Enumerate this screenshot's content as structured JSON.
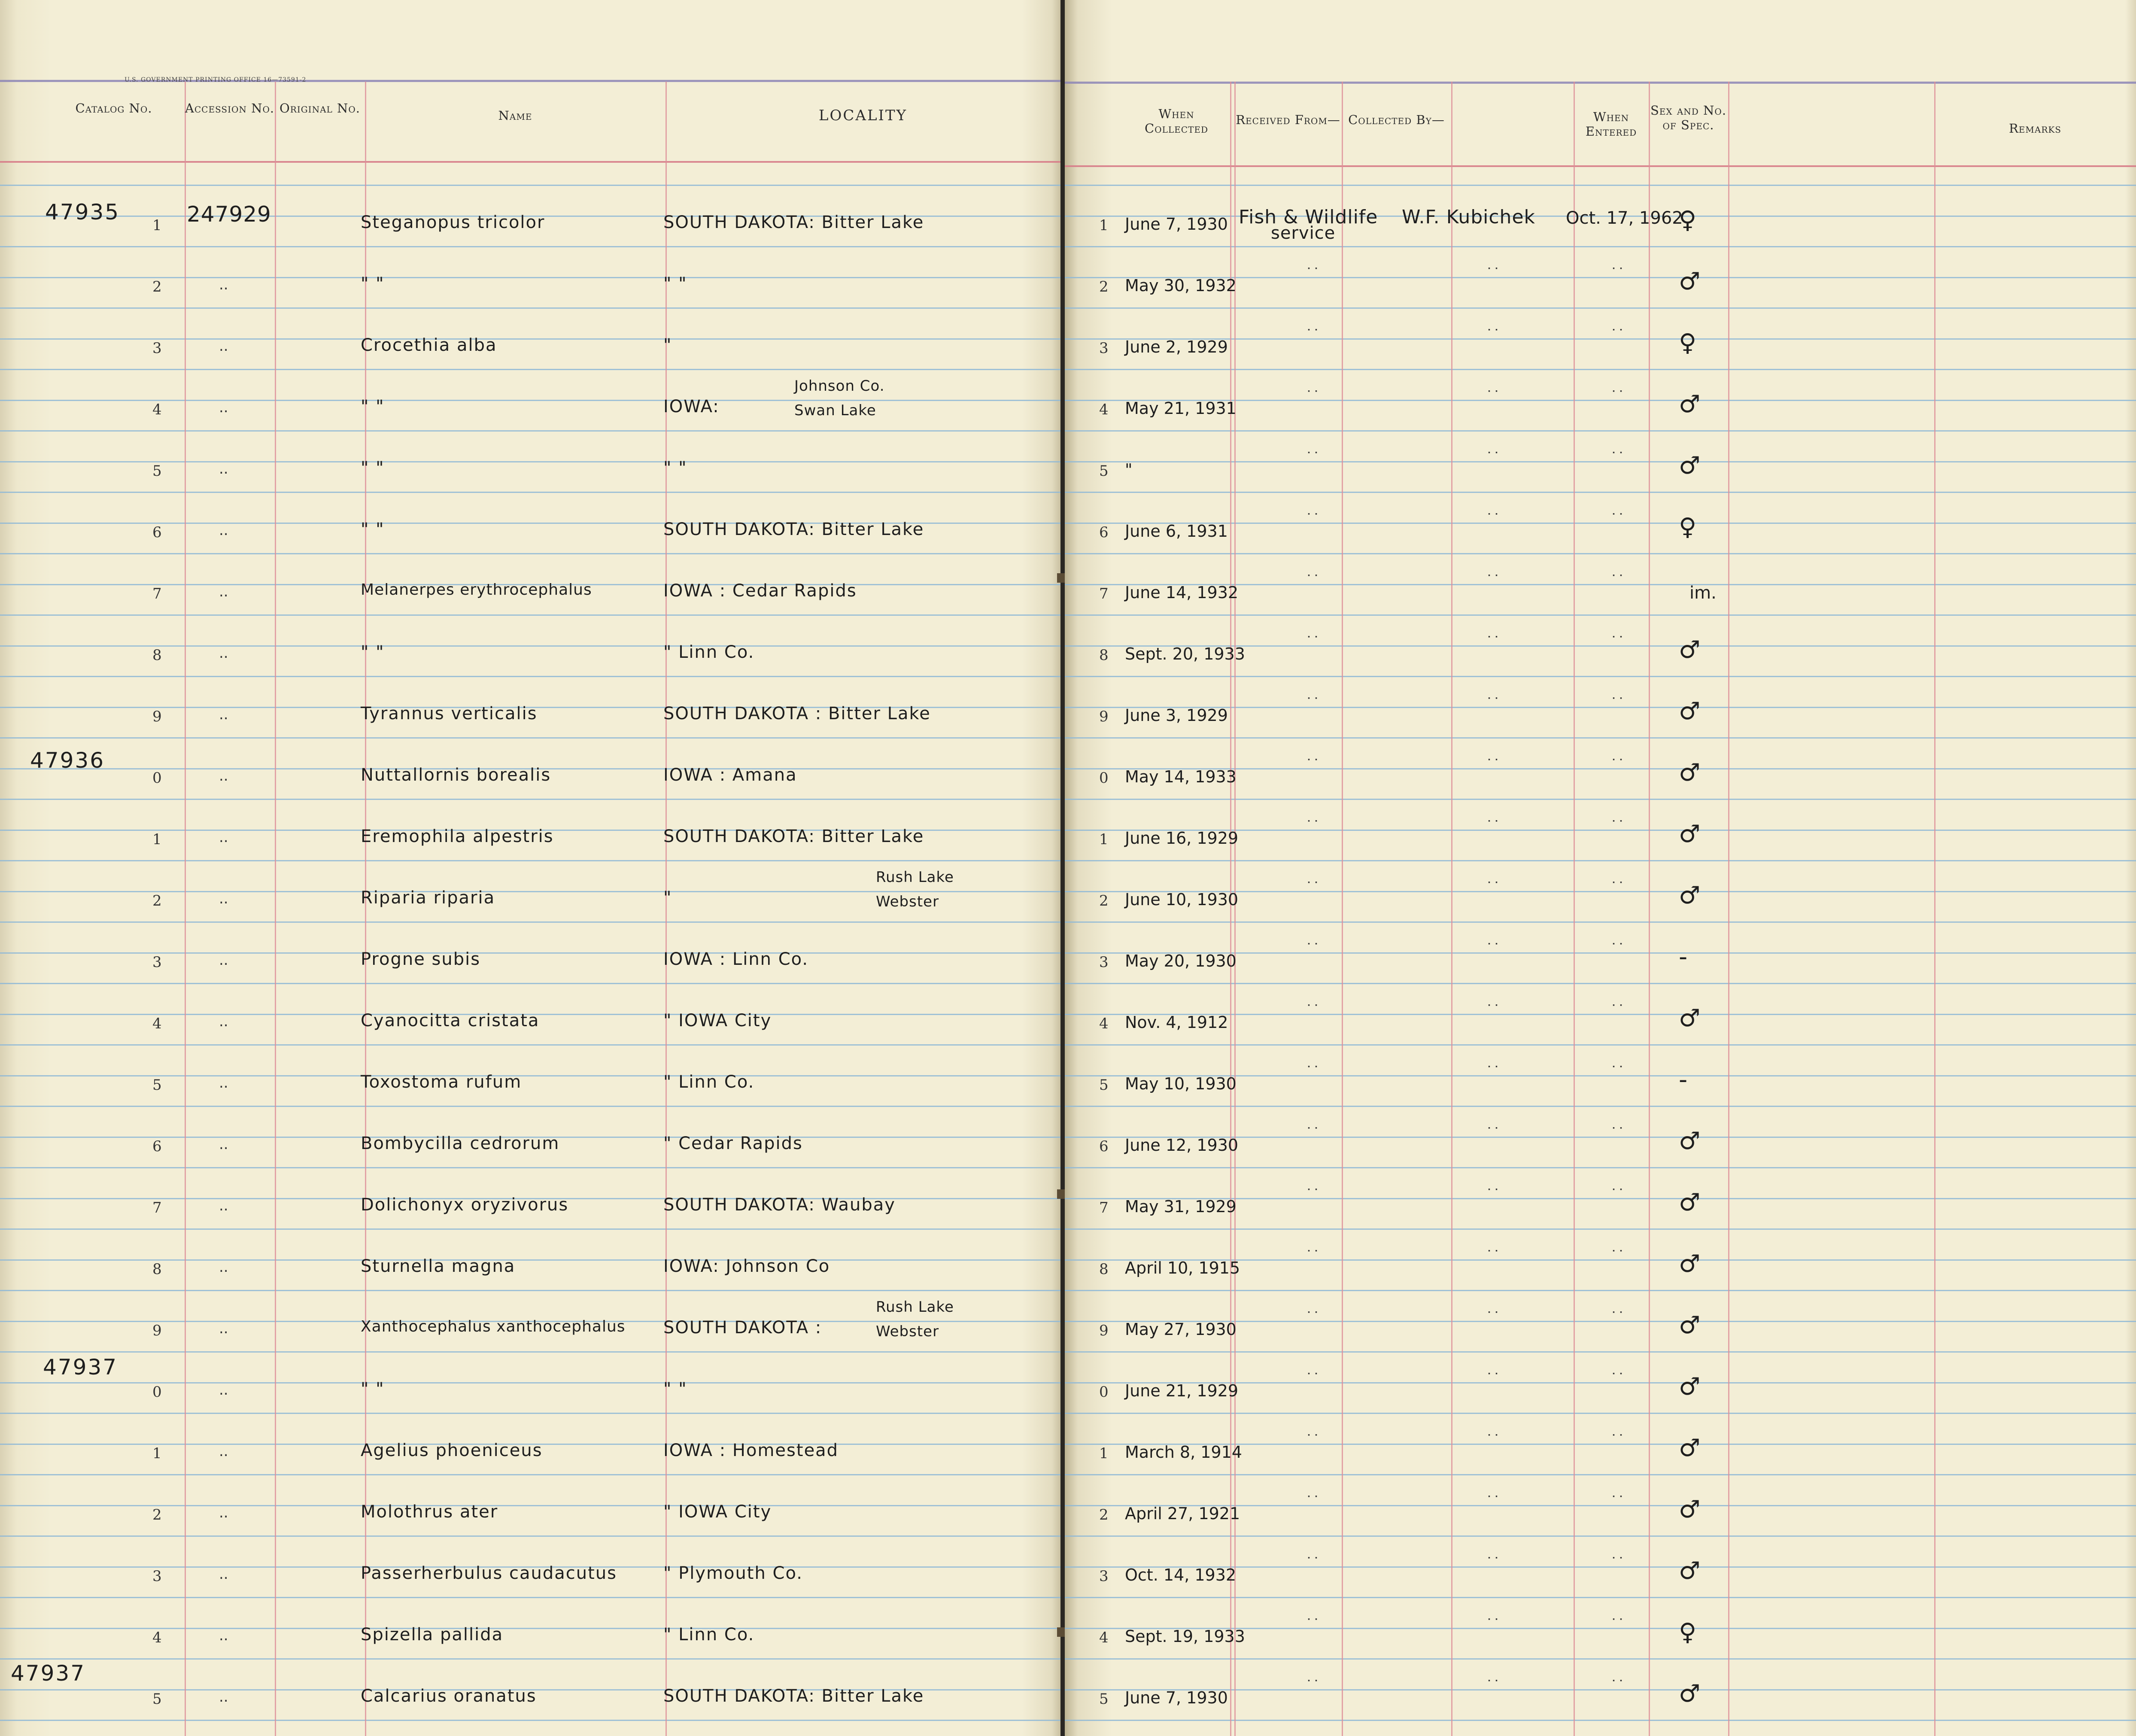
{
  "header": {
    "printer_line": "U.S. GOVERNMENT PRINTING OFFICE 16—73591-2",
    "left_columns": {
      "catalog": "Catalog No.",
      "accession": "Accession No.",
      "original": "Original No.",
      "name": "Name",
      "locality": "LOCALITY"
    },
    "right_columns": {
      "when_collected": "When Collected",
      "received_from": "Received From—",
      "collected_by": "Collected By—",
      "when_entered": "When Entered",
      "sex": "Sex and No. of Spec.",
      "remarks": "Remarks"
    }
  },
  "first_entry": {
    "catalog": "47935",
    "accession": "247929",
    "received_from_1": "Fish & Wildlife",
    "received_from_2": "service",
    "collected_by": "W.F. Kubichek",
    "entered": "Oct. 17, 1962"
  },
  "catalog_prefixes": {
    "r10": "47936",
    "r20": "47937",
    "r25": "47937"
  },
  "rows": [
    {
      "n": "1",
      "name": "Steganopus   tricolor",
      "loc": "SOUTH  DAKOTA:  Bitter  Lake",
      "date": "June 7, 1930",
      "sex": "♀"
    },
    {
      "n": "2",
      "name": "\"          \"",
      "loc": "\"                \"",
      "date": "May 30, 1932",
      "sex": "♂"
    },
    {
      "n": "3",
      "name": "Crocethia   alba",
      "loc": "\"",
      "date": "June 2, 1929",
      "sex": "♀"
    },
    {
      "n": "4",
      "name": "\"          \"",
      "loc": "IOWA:",
      "loc2a": "Johnson Co.",
      "loc2b": "Swan Lake",
      "date": "May 21, 1931",
      "sex": "♂"
    },
    {
      "n": "5",
      "name": "\"          \"",
      "loc": "\"        \"",
      "date": "\"",
      "sex": "♂"
    },
    {
      "n": "6",
      "name": "\"          \"",
      "loc": "SOUTH  DAKOTA:  Bitter  Lake",
      "date": "June 6, 1931",
      "sex": "♀"
    },
    {
      "n": "7",
      "name": "Melanerpes  erythrocephalus",
      "loc": "IOWA :  Cedar  Rapids",
      "date": "June 14, 1932",
      "sex": "im."
    },
    {
      "n": "8",
      "name": "\"          \"",
      "loc": "\"           Linn  Co.",
      "date": "Sept. 20, 1933",
      "sex": "♂"
    },
    {
      "n": "9",
      "name": "Tyrannus   verticalis",
      "loc": "SOUTH  DAKOTA :  Bitter  Lake",
      "date": "June 3, 1929",
      "sex": "♂"
    },
    {
      "n": "0",
      "name": "Nuttallornis   borealis",
      "loc": "IOWA :  Amana",
      "date": "May 14, 1933",
      "sex": "♂"
    },
    {
      "n": "1",
      "name": "Eremophila   alpestris",
      "loc": "SOUTH  DAKOTA:  Bitter  Lake",
      "date": "June 16, 1929",
      "sex": "♂"
    },
    {
      "n": "2",
      "name": "Riparia   riparia",
      "loc": "\"",
      "loc2a": "Rush  Lake",
      "loc2b": "Webster",
      "date": "June 10, 1930",
      "sex": "♂"
    },
    {
      "n": "3",
      "name": "Progne   subis",
      "loc": "IOWA :      Linn  Co.",
      "date": "May 20, 1930",
      "sex": "-"
    },
    {
      "n": "4",
      "name": "Cyanocitta   cristata",
      "loc": "\"           IOWA  City",
      "date": "Nov. 4, 1912",
      "sex": "♂"
    },
    {
      "n": "5",
      "name": "Toxostoma   rufum",
      "loc": "\"           Linn  Co.",
      "date": "May 10, 1930",
      "sex": "-"
    },
    {
      "n": "6",
      "name": "Bombycilla   cedrorum",
      "loc": "\"         Cedar  Rapids",
      "date": "June 12, 1930",
      "sex": "♂"
    },
    {
      "n": "7",
      "name": "Dolichonyx   oryzivorus",
      "loc": "SOUTH  DAKOTA:  Waubay",
      "date": "May 31, 1929",
      "sex": "♂"
    },
    {
      "n": "8",
      "name": "Sturnella   magna",
      "loc": "IOWA:      Johnson  Co",
      "date": "April 10, 1915",
      "sex": "♂"
    },
    {
      "n": "9",
      "name": "Xanthocephalus  xanthocephalus",
      "loc": "SOUTH  DAKOTA :",
      "loc2a": "Rush Lake",
      "loc2b": "Webster",
      "date": "May 27, 1930",
      "sex": "♂"
    },
    {
      "n": "0",
      "name": "\"          \"",
      "loc": "\"          \"",
      "date": "June 21, 1929",
      "sex": "♂"
    },
    {
      "n": "1",
      "name": "Agelius   phoeniceus",
      "loc": "IOWA :   Homestead",
      "date": "March 8, 1914",
      "sex": "♂"
    },
    {
      "n": "2",
      "name": "Molothrus   ater",
      "loc": "\"           IOWA  City",
      "date": "April 27, 1921",
      "sex": "♂"
    },
    {
      "n": "3",
      "name": "Passerherbulus  caudacutus",
      "loc": "\"       Plymouth  Co.",
      "date": "Oct. 14, 1932",
      "sex": "♂"
    },
    {
      "n": "4",
      "name": "Spizella    pallida",
      "loc": "\"          Linn  Co.",
      "date": "Sept. 19, 1933",
      "sex": "♀"
    },
    {
      "n": "5",
      "name": "Calcarius   oranatus",
      "loc": "SOUTH  DAKOTA:  Bitter  Lake",
      "date": "June 7, 1930",
      "sex": "♂"
    }
  ],
  "colors": {
    "paper": "#f3eed6",
    "rule_blue": "#8fb8d6",
    "rule_red": "#d77c88",
    "ink": "#1e1e1e"
  }
}
